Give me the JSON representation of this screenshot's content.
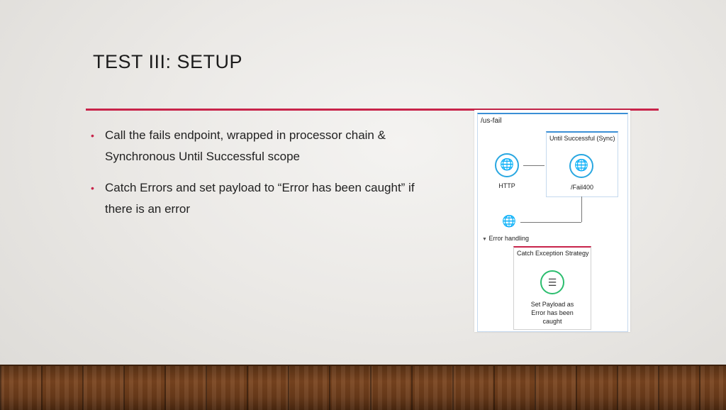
{
  "slide": {
    "title": "TEST III: SETUP",
    "bullets": [
      "Call the fails endpoint, wrapped in processor chain & Synchronous Until Successful scope",
      "Catch Errors and set payload to “Error has been caught” if there is an error"
    ]
  },
  "diagram": {
    "flow_name": "/us-fail",
    "scope_name": "Until Successful (Sync)",
    "http_label": "HTTP",
    "fail_label": "/Fail400",
    "error_handling_label": "Error handling",
    "catch_name": "Catch Exception Strategy",
    "set_payload_label": "Set Payload as Error has been caught",
    "colors": {
      "accent": "#c8244a",
      "flow_border": "#3a8fd6",
      "endpoint": "#29a7e1",
      "transformer": "#2bbd6e"
    },
    "icons": {
      "endpoint": "globe-icon",
      "transformer": "document-icon",
      "collapse": "triangle-down-icon"
    }
  }
}
